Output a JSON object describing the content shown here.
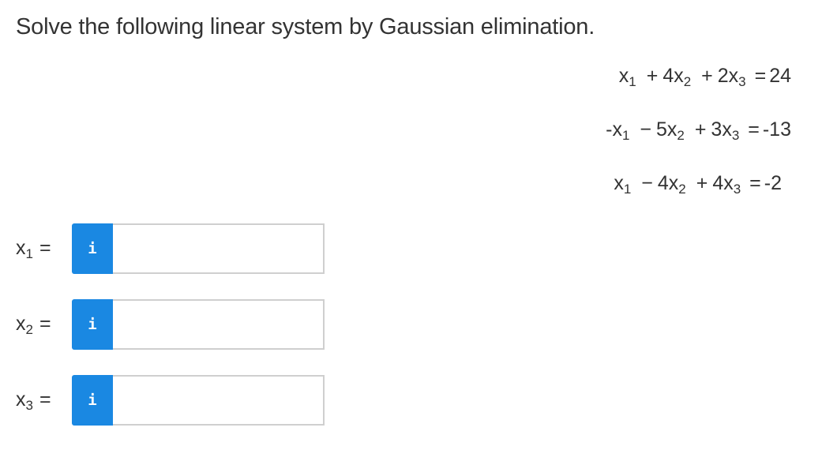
{
  "question": {
    "text": "Solve the following linear system by Gaussian elimination."
  },
  "equations": [
    {
      "t1_sign": "",
      "t1_var": "x",
      "t1_sub": "1",
      "op1": "+",
      "t2": "4x",
      "t2_sub": "2",
      "op2": "+",
      "t3": "2x",
      "t3_sub": "3",
      "rhs": "24"
    },
    {
      "t1_sign": "-",
      "t1_var": "x",
      "t1_sub": "1",
      "op1": "−",
      "t2": "5x",
      "t2_sub": "2",
      "op2": "+",
      "t3": "3x",
      "t3_sub": "3",
      "rhs": "-13"
    },
    {
      "t1_sign": "",
      "t1_var": "x",
      "t1_sub": "1",
      "op1": "−",
      "t2": "4x",
      "t2_sub": "2",
      "op2": "+",
      "t3": "4x",
      "t3_sub": "3",
      "rhs": "-2"
    }
  ],
  "equals_sign": "=",
  "answers": [
    {
      "var": "x",
      "sub": "1",
      "equals": "=",
      "info_label": "i",
      "value": "",
      "info_icon": "info-icon"
    },
    {
      "var": "x",
      "sub": "2",
      "equals": "=",
      "info_label": "i",
      "value": "",
      "info_icon": "info-icon"
    },
    {
      "var": "x",
      "sub": "3",
      "equals": "=",
      "info_label": "i",
      "value": "",
      "info_icon": "info-icon"
    }
  ],
  "colors": {
    "text": "#333333",
    "info_button": "#1a88e2",
    "input_border": "#cfcfcf"
  }
}
